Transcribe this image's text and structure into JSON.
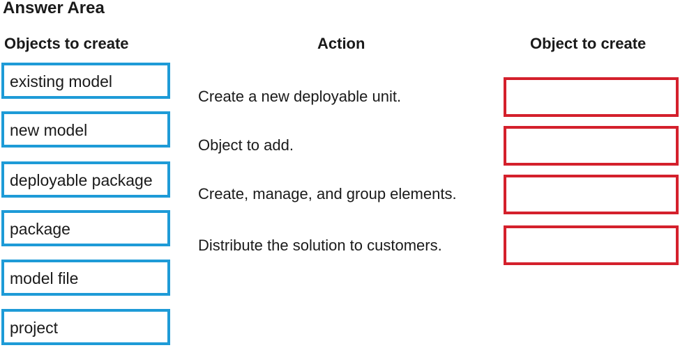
{
  "title": "Answer Area",
  "columns": {
    "objects": "Objects to create",
    "action": "Action",
    "target": "Object to create"
  },
  "objects": [
    {
      "label": "existing model"
    },
    {
      "label": "new model"
    },
    {
      "label": "deployable package"
    },
    {
      "label": "package"
    },
    {
      "label": "model file"
    },
    {
      "label": "project"
    }
  ],
  "actions": [
    {
      "label": "Create a new deployable unit.",
      "answer": ""
    },
    {
      "label": "Object to add.",
      "answer": ""
    },
    {
      "label": "Create, manage, and group elements.",
      "answer": ""
    },
    {
      "label": "Distribute the solution to customers.",
      "answer": ""
    }
  ],
  "colors": {
    "source_border": "#1e9bd7",
    "target_border": "#d4202c"
  }
}
